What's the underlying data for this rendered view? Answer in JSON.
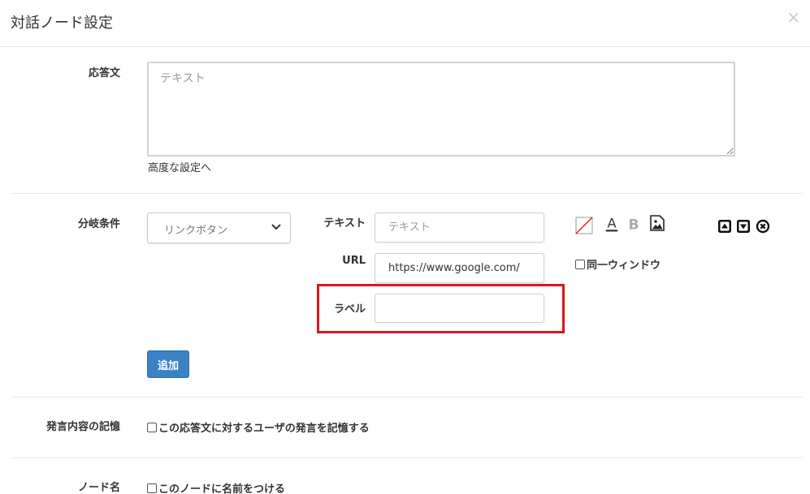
{
  "header": {
    "title": "対話ノード設定",
    "close_glyph": "×"
  },
  "reply": {
    "label": "応答文",
    "placeholder": "テキスト",
    "advanced_link": "高度な設定へ"
  },
  "branch": {
    "label": "分岐条件",
    "select_value": "リンクボタン",
    "text_label": "テキスト",
    "text_placeholder": "テキスト",
    "url_label": "URL",
    "url_value": "https://www.google.com/",
    "label_label": "ラベル",
    "label_value": "",
    "same_window": "同一ウィンドウ",
    "add_button": "追加"
  },
  "memory": {
    "label": "発言内容の記憶",
    "checkbox": "この応答文に対するユーザの発言を記憶する"
  },
  "node_name": {
    "label": "ノード名",
    "checkbox": "このノードに名前をつける"
  },
  "colors": {
    "highlight": "#e1141e",
    "primary": "#3b82c4"
  }
}
